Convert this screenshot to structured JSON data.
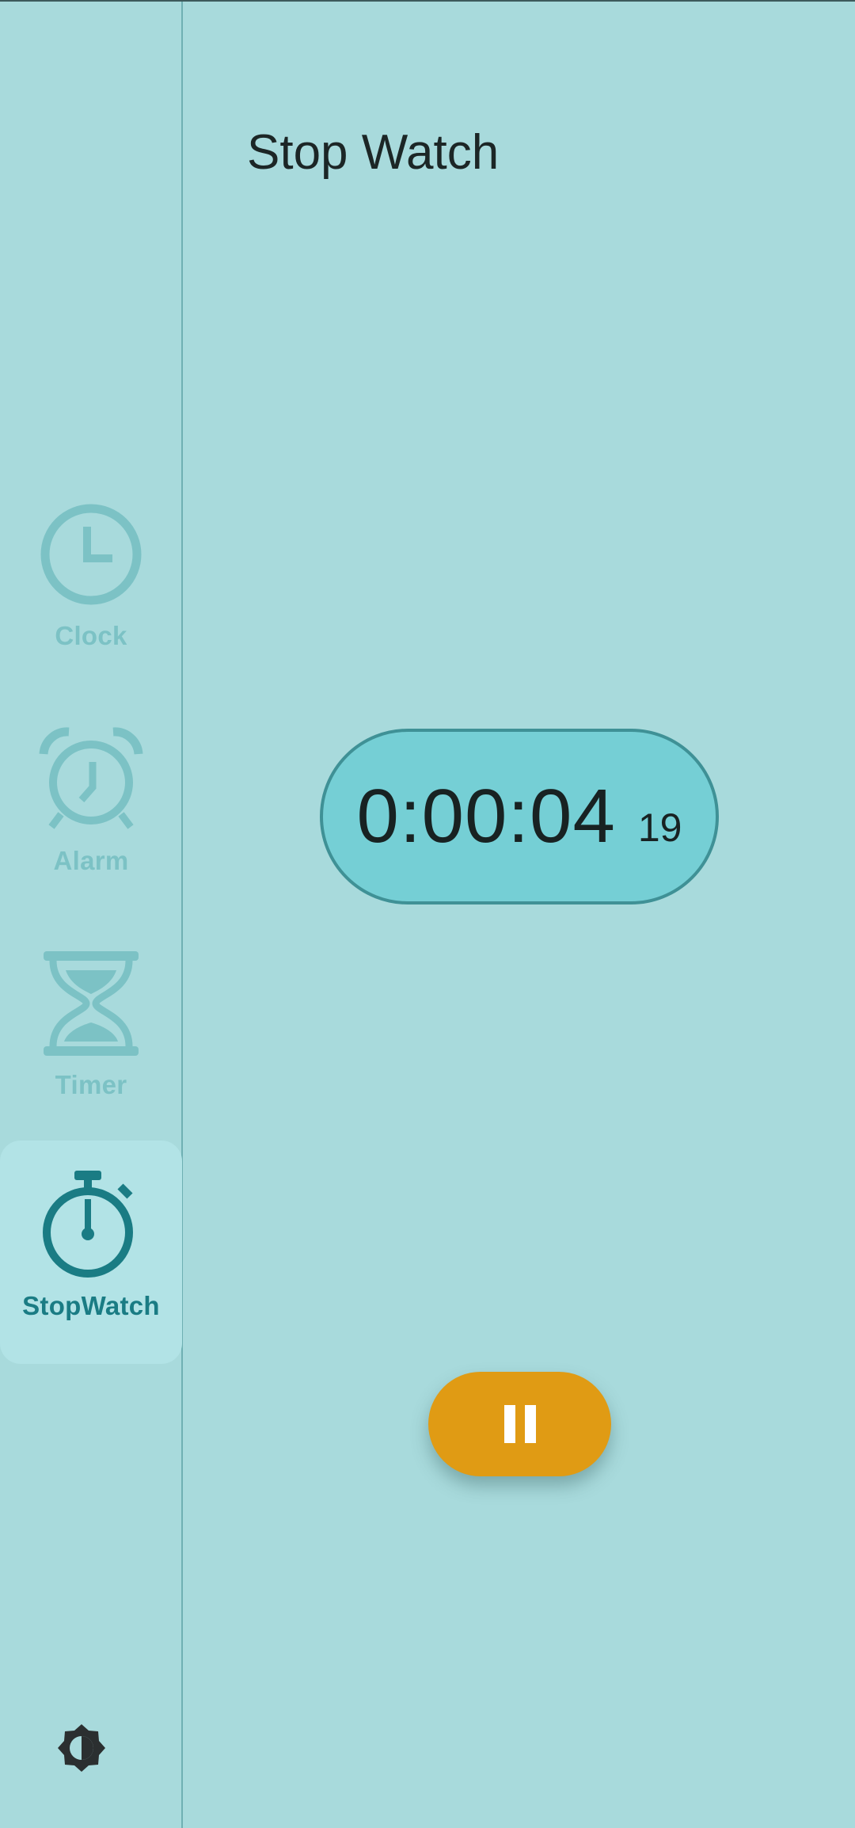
{
  "header": {
    "title": "Stop Watch"
  },
  "nav": {
    "items": [
      {
        "label": "Clock",
        "icon": "clock-icon"
      },
      {
        "label": "Alarm",
        "icon": "alarm-icon"
      },
      {
        "label": "Timer",
        "icon": "hourglass-icon"
      },
      {
        "label": "StopWatch",
        "icon": "stopwatch-icon",
        "active": true
      }
    ],
    "theme_toggle_icon": "brightness-icon"
  },
  "stopwatch": {
    "time": "0:00:04",
    "centiseconds": "19",
    "control_icon": "pause-icon"
  },
  "colors": {
    "background": "#a8dadc",
    "inactive": "#7cc2c5",
    "active": "#1a7c84",
    "pill": "#75cfd5",
    "pill_border": "#3f9196",
    "button": "#e09b14"
  }
}
